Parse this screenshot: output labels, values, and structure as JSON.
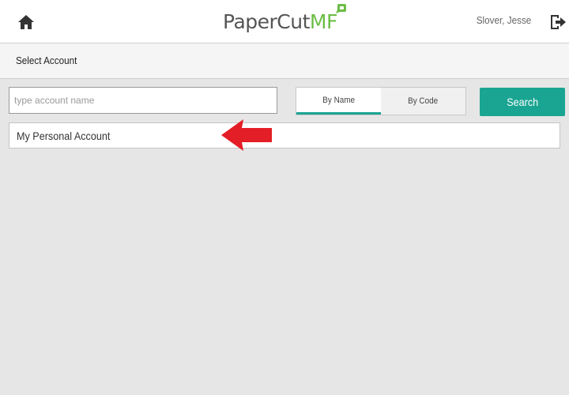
{
  "header": {
    "home_icon": "home-icon",
    "logo_text": "PaperCut",
    "logo_suffix": "MF",
    "user_name": "Slover, Jesse",
    "logout_icon": "logout-icon"
  },
  "subheader": {
    "title": "Select Account"
  },
  "search": {
    "placeholder": "type account name",
    "value": ""
  },
  "toggle": {
    "by_name": "By Name",
    "by_code": "By Code",
    "selected": "By Name"
  },
  "search_button": {
    "label": "Search"
  },
  "accounts": [
    {
      "label": "My Personal Account"
    }
  ],
  "annotation": {
    "arrow_icon": "red-arrow-icon"
  },
  "colors": {
    "accent": "#1aa592",
    "logo_green": "#6bbd45",
    "background": "#e6e6e6",
    "annotation_red": "#e41e26"
  }
}
